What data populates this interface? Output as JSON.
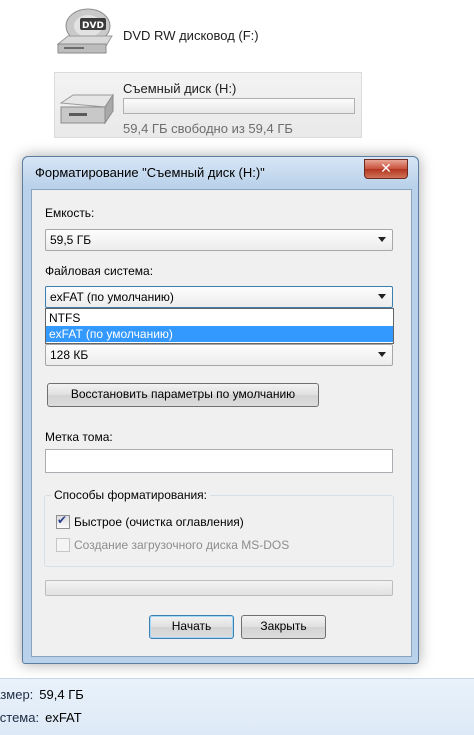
{
  "explorer": {
    "drives": [
      {
        "name": "DVD RW дисковод (F:)",
        "icon": "dvd-drive-icon",
        "disc_label": "DVD"
      },
      {
        "name": "Съемный диск (H:)",
        "free_text": "59,4 ГБ свободно из 59,4 ГБ",
        "icon": "removable-drive-icon",
        "used_fraction": 0.0
      }
    ],
    "status": {
      "size_label": "размер:",
      "size_value": "59,4 ГБ",
      "fs_label": "система:",
      "fs_value": "exFAT"
    }
  },
  "dialog": {
    "title": "Форматирование \"Съемный диск (H:)\"",
    "close_glyph": "✕",
    "capacity": {
      "label": "Емкость:",
      "value": "59,5 ГБ"
    },
    "filesystem": {
      "label": "Файловая система:",
      "value": "exFAT (по умолчанию)",
      "options": [
        "NTFS",
        "exFAT (по умолчанию)"
      ],
      "selected_index": 1
    },
    "cluster": {
      "value": "128 КБ"
    },
    "restore_defaults_label": "Восстановить параметры по умолчанию",
    "volume_label": {
      "label": "Метка тома:",
      "value": ""
    },
    "format_options": {
      "title": "Способы форматирования:",
      "quick": {
        "label": "Быстрое (очистка оглавления)",
        "checked": true
      },
      "msdos": {
        "label": "Создание загрузочного диска MS-DOS",
        "checked": false,
        "disabled": true
      }
    },
    "progress": 0,
    "start_label": "Начать",
    "close_label": "Закрыть"
  },
  "colors": {
    "selection": "#3399ff",
    "dialog_frame": "#b9d1ea",
    "client_bg": "#f0f0f0",
    "close_button": "#c7503a"
  }
}
